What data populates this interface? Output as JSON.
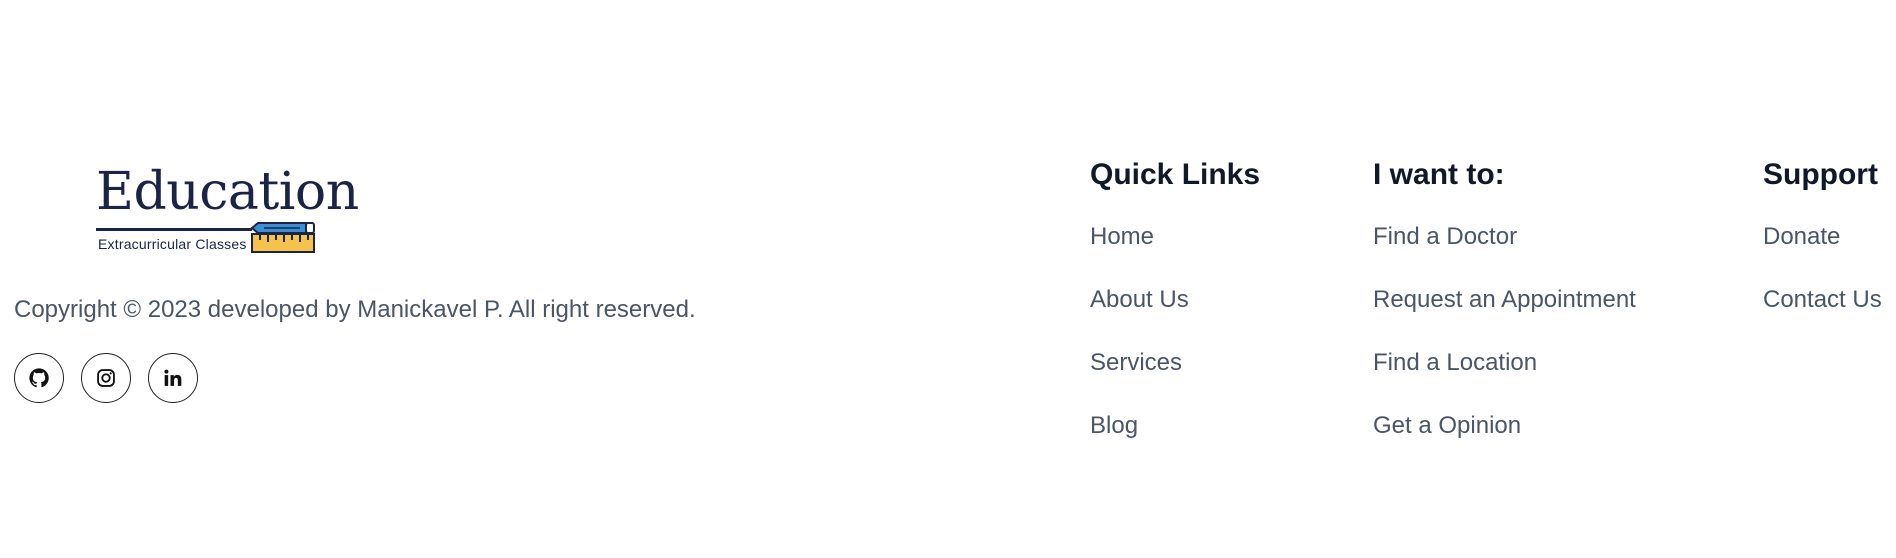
{
  "brand": {
    "logo_title": "Education",
    "logo_subtitle": "Extracurricular Classes",
    "copyright": "Copyright © 2023 developed by Manickavel P. All right reserved."
  },
  "socials": [
    {
      "icon": "github-icon"
    },
    {
      "icon": "instagram-icon"
    },
    {
      "icon": "linkedin-icon"
    }
  ],
  "quick_links": {
    "title": "Quick Links",
    "items": [
      "Home",
      "About Us",
      "Services",
      "Blog"
    ]
  },
  "i_want_to": {
    "title": "I want to:",
    "items": [
      "Find a Doctor",
      "Request an Appointment",
      "Find a Location",
      "Get a Opinion"
    ]
  },
  "support": {
    "title": "Support",
    "items": [
      "Donate",
      "Contact Us"
    ]
  },
  "colors": {
    "logo_navy": "#1b2447",
    "text_gray": "#4a5566",
    "heading": "#111827",
    "pencil_blue": "#3a8fd1",
    "ruler_yellow": "#f5c24c"
  }
}
